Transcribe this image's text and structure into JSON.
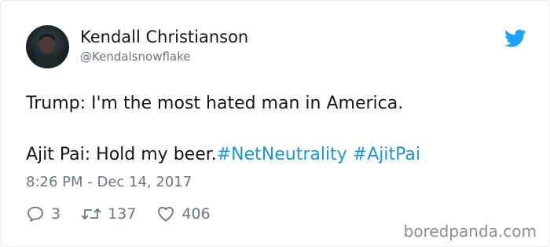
{
  "user": {
    "name": "Kendall Christianson",
    "handle": "@Kendalsnowflake"
  },
  "tweet": {
    "line1": "Trump: I'm the most hated man in America.",
    "line2_text": "Ajit Pai: Hold my beer.",
    "hashtags": [
      "#NetNeutrality",
      "#AjitPai"
    ],
    "timestamp": "8:26 PM - Dec 14, 2017"
  },
  "actions": {
    "replies": "3",
    "retweets": "137",
    "likes": "406"
  },
  "watermark": "boredpanda.com",
  "colors": {
    "text": "#14171a",
    "secondary": "#657786",
    "link": "#1b95e0",
    "twitter_blue": "#1da1f2"
  },
  "icons": [
    "twitter-bird-icon",
    "reply-icon",
    "retweet-icon",
    "heart-icon"
  ]
}
